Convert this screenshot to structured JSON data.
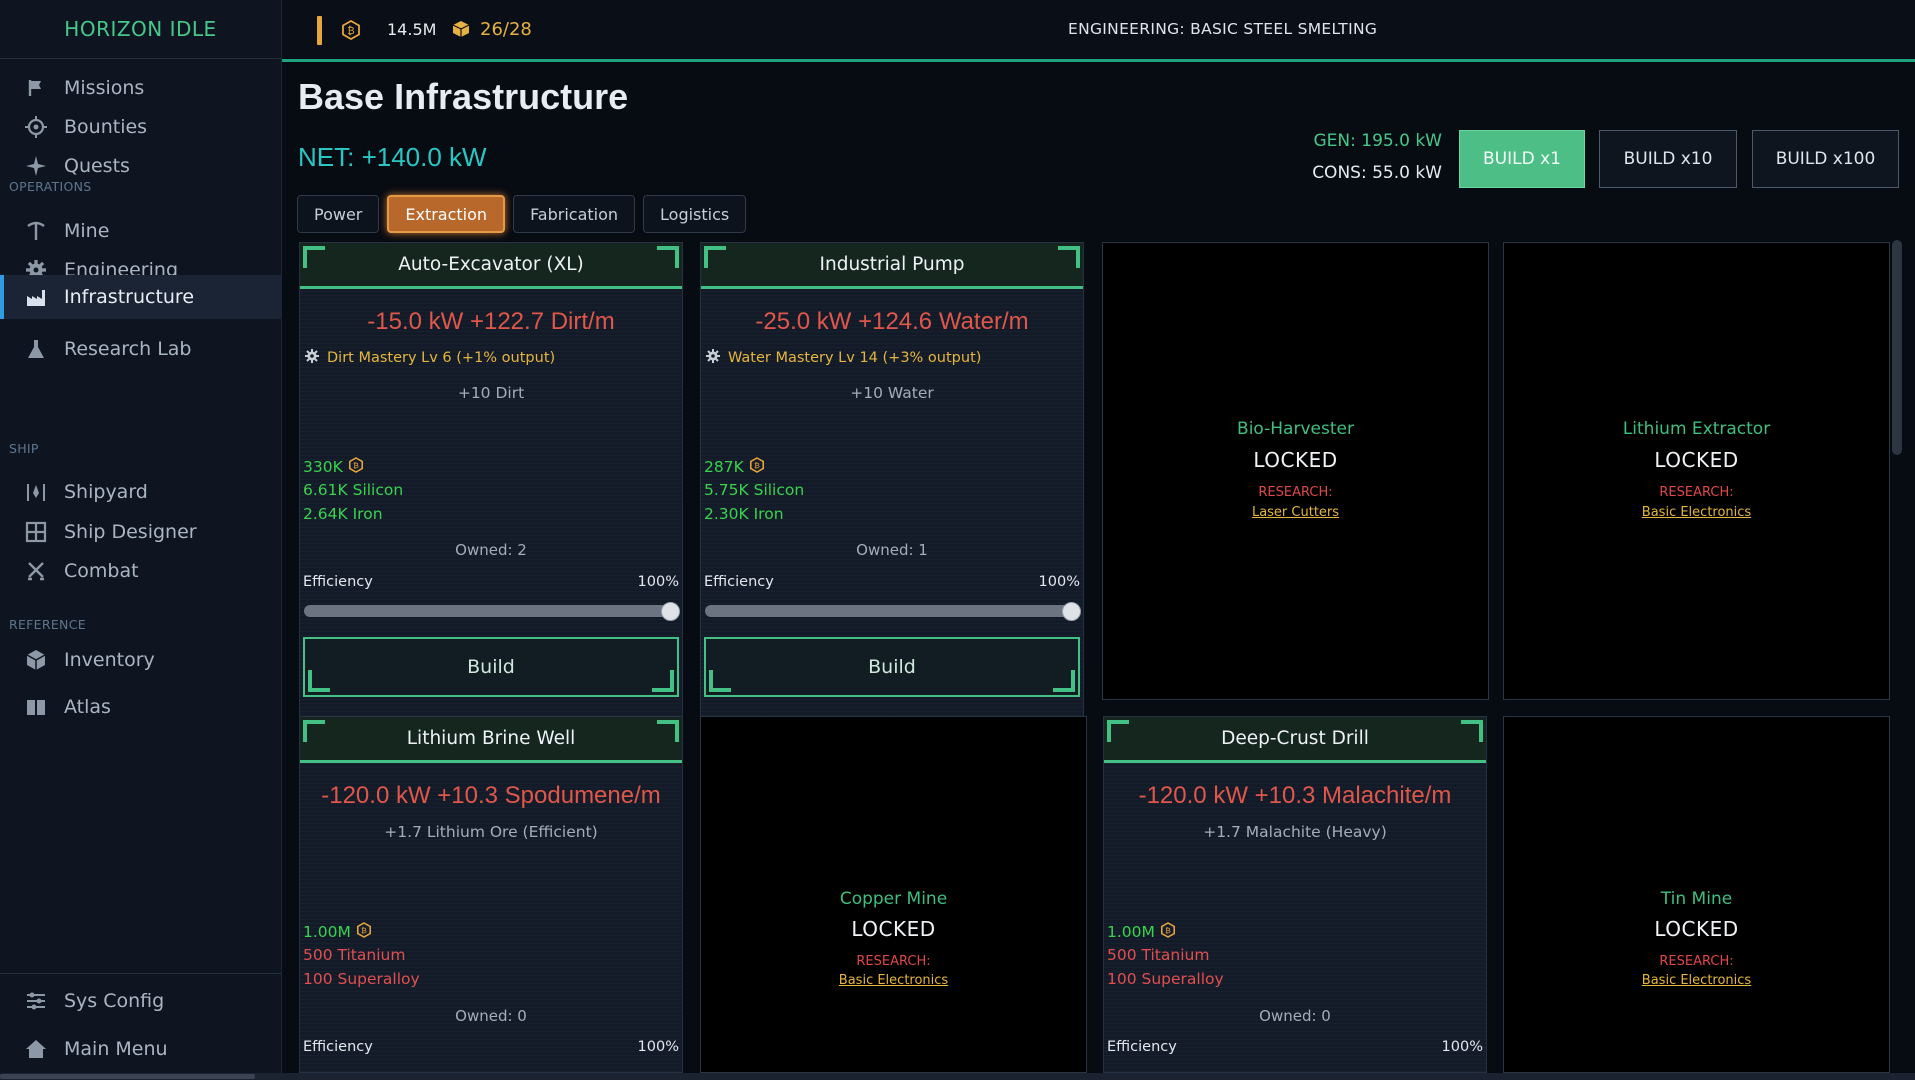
{
  "app": {
    "brand": "HORIZON IDLE"
  },
  "sidebar": {
    "items": [
      {
        "label": "Missions",
        "icon": "flag-icon"
      },
      {
        "label": "Bounties",
        "icon": "target-icon"
      },
      {
        "label": "Quests",
        "icon": "sparkle-icon"
      },
      {
        "label": "Mine",
        "icon": "pickaxe-icon"
      },
      {
        "label": "Engineering",
        "icon": "gear-icon"
      },
      {
        "label": "Infrastructure",
        "icon": "factory-icon",
        "active": true
      },
      {
        "label": "Research Lab",
        "icon": "flask-icon"
      },
      {
        "label": "Shipyard",
        "icon": "shipyard-icon"
      },
      {
        "label": "Ship Designer",
        "icon": "grid-icon"
      },
      {
        "label": "Combat",
        "icon": "swords-icon"
      },
      {
        "label": "Inventory",
        "icon": "cube-icon"
      },
      {
        "label": "Atlas",
        "icon": "book-icon"
      }
    ],
    "sections": {
      "operations": "OPERATIONS",
      "ship": "SHIP",
      "reference": "REFERENCE"
    },
    "bottom": [
      {
        "label": "Sys Config",
        "icon": "sliders-icon"
      },
      {
        "label": "Main Menu",
        "icon": "home-icon"
      }
    ]
  },
  "topbar": {
    "credits": "14.5M",
    "cargo": "26/28",
    "status": "ENGINEERING: BASIC STEEL SMELTING"
  },
  "main": {
    "title": "Base Infrastructure",
    "net": "NET: +140.0 kW",
    "gen": "GEN: 195.0 kW",
    "cons": "CONS: 55.0 kW",
    "build_buttons": [
      "BUILD x1",
      "BUILD x10",
      "BUILD x100"
    ],
    "tabs": [
      "Power",
      "Extraction",
      "Fabrication",
      "Logistics"
    ],
    "active_tab": "Extraction"
  },
  "cards": [
    {
      "name": "Auto-Excavator (XL)",
      "rate": "-15.0 kW +122.7 Dirt/m",
      "mastery": "Dirt Mastery  Lv 6  (+1% output)",
      "bonus": "+10 Dirt",
      "costs": [
        "330K",
        "6.61K Silicon",
        "2.64K Iron"
      ],
      "owned": "Owned: 2",
      "eff_label": "Efficiency",
      "eff_value": "100%",
      "efficiency": 1.0,
      "build": "Build"
    },
    {
      "name": "Industrial Pump",
      "rate": "-25.0 kW +124.6 Water/m",
      "mastery": "Water Mastery  Lv 14  (+3% output)",
      "bonus": "+10 Water",
      "costs": [
        "287K",
        "5.75K Silicon",
        "2.30K Iron"
      ],
      "owned": "Owned: 1",
      "eff_label": "Efficiency",
      "eff_value": "100%",
      "efficiency": 1.0,
      "build": "Build"
    },
    {
      "name": "Lithium Brine Well",
      "rate": "-120.0 kW +10.3 Spodumene/m",
      "bonus": "+1.7 Lithium Ore (Efficient)",
      "costs": [
        "1.00M",
        "500 Titanium",
        "100 Superalloy"
      ],
      "owned": "Owned: 0",
      "eff_label": "Efficiency",
      "eff_value": "100%"
    },
    {
      "name": "Deep-Crust Drill",
      "rate": "-120.0 kW +10.3 Malachite/m",
      "bonus": "+1.7 Malachite (Heavy)",
      "costs": [
        "1.00M",
        "500 Titanium",
        "100 Superalloy"
      ],
      "owned": "Owned: 0",
      "eff_label": "Efficiency",
      "eff_value": "100%"
    }
  ],
  "locked": [
    {
      "name": "Bio-Harvester",
      "status": "LOCKED",
      "research": "RESEARCH:",
      "req": "Laser Cutters"
    },
    {
      "name": "Lithium Extractor",
      "status": "LOCKED",
      "research": "RESEARCH:",
      "req": "Basic Electronics"
    },
    {
      "name": "Copper Mine",
      "status": "LOCKED",
      "research": "RESEARCH:",
      "req": "Basic Electronics"
    },
    {
      "name": "Tin Mine",
      "status": "LOCKED",
      "research": "RESEARCH:",
      "req": "Basic Electronics"
    }
  ],
  "colors": {
    "accent_green": "#43c083",
    "net_cyan": "#29c7c3",
    "warning_red": "#e0574a",
    "gold": "#e5b63d",
    "active_tab": "#b8682a"
  }
}
